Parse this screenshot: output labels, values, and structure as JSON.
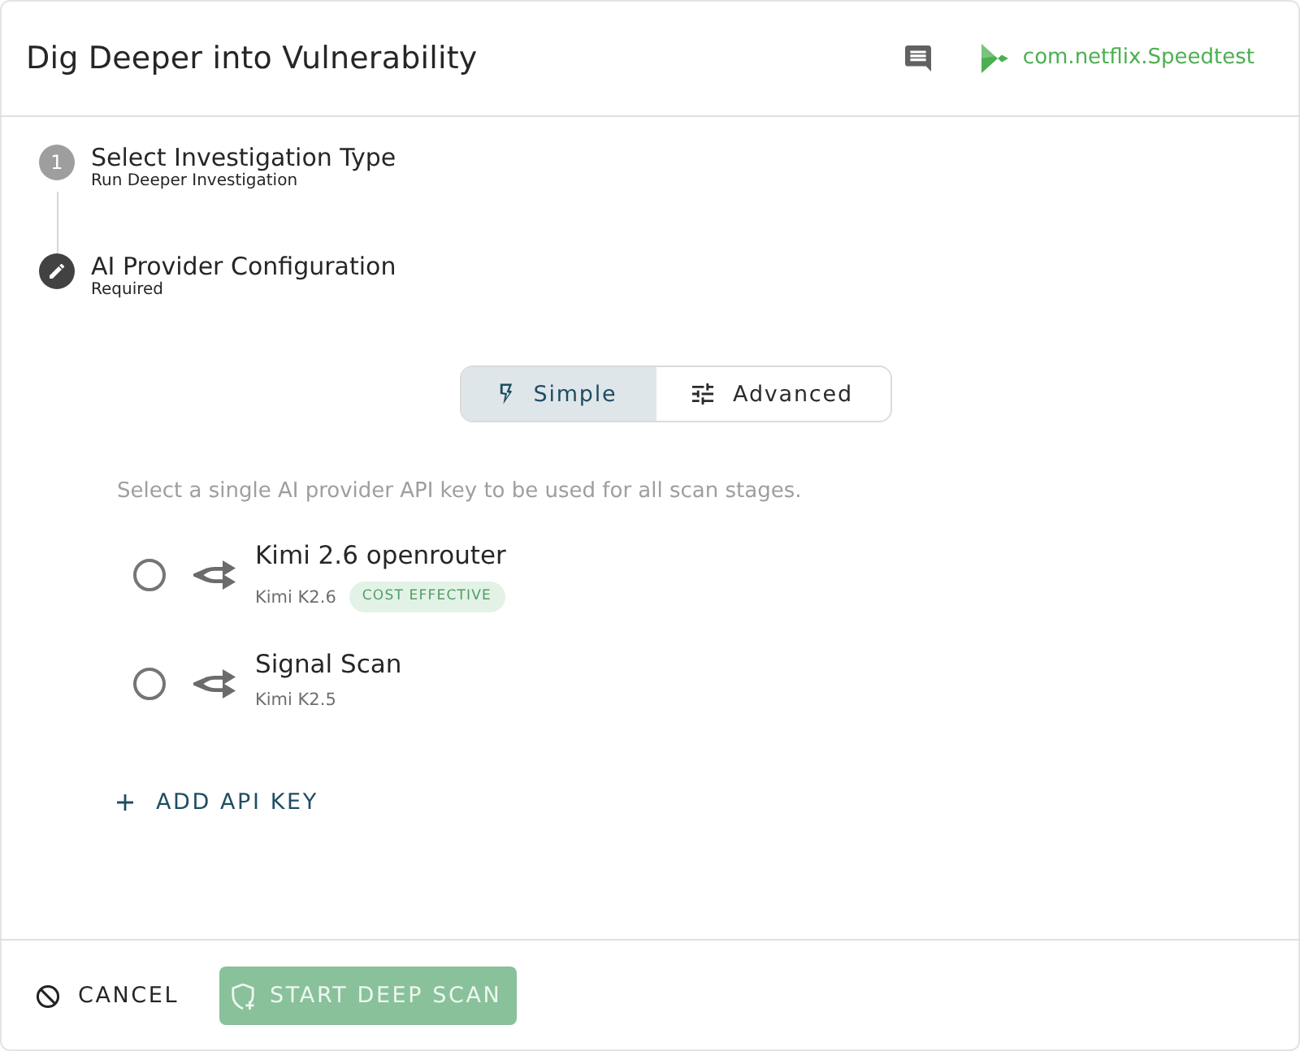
{
  "dialog": {
    "title": "Dig Deeper into Vulnerability",
    "app_package": "com.netflix.Speedtest"
  },
  "stepper": [
    {
      "kind": "number",
      "number": "1",
      "title": "Select Investigation Type",
      "subtitle": "Run Deeper Investigation"
    },
    {
      "kind": "edit",
      "title": "AI Provider Configuration",
      "subtitle": "Required"
    }
  ],
  "mode_toggle": [
    {
      "kind": "simple",
      "label": "Simple",
      "selected": true
    },
    {
      "kind": "advanced",
      "label": "Advanced",
      "selected": false
    }
  ],
  "description": "Select a single AI provider API key to be used for all scan stages.",
  "providers": [
    {
      "name": "Kimi 2.6 openrouter",
      "model": "Kimi K2.6",
      "badge": "COST EFFECTIVE",
      "selected": false
    },
    {
      "name": "Signal Scan",
      "model": "Kimi K2.5",
      "selected": false
    }
  ],
  "add_key": {
    "label": "ADD API KEY"
  },
  "footer": {
    "cancel": {
      "label": "CANCEL"
    },
    "start": {
      "label": "START DEEP SCAN",
      "disabled": true
    }
  }
}
